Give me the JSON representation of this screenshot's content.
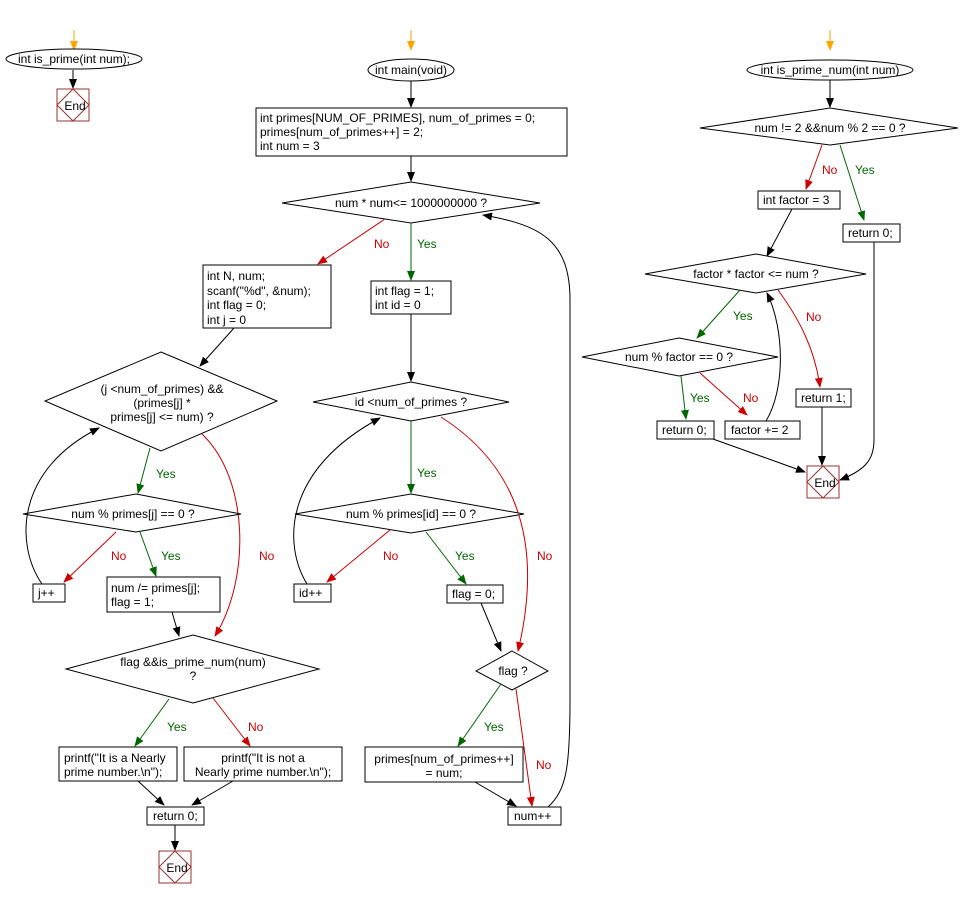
{
  "colors": {
    "start_arrow": "#ffa500",
    "normal": "#000000",
    "yes": "#006600",
    "no": "#cc0000",
    "end_border": "#993333"
  },
  "labels": {
    "yes": "Yes",
    "no": "No",
    "end": "End"
  },
  "is_prime": {
    "start": "int is_prime(int num);",
    "end": "End"
  },
  "main": {
    "start": "int main(void)",
    "init": [
      "int primes[NUM_OF_PRIMES], num_of_primes = 0;",
      "primes[num_of_primes++] = 2;",
      "int num = 3"
    ],
    "cond_outer": "num * num<= 1000000000 ?",
    "read_input": [
      "int N, num;",
      "scanf(\"%d\", &num);",
      "int flag = 0;",
      "int j = 0"
    ],
    "cond_j": [
      "(j <num_of_primes) &&",
      "(primes[j] *",
      "primes[j] <= num) ?"
    ],
    "cond_mod_j": "num % primes[j] == 0 ?",
    "j_inc": "j++",
    "divide": [
      "num /= primes[j];",
      "flag = 1;"
    ],
    "cond_final": [
      "flag &&is_prime_num(num)",
      "?"
    ],
    "print_yes": [
      "printf(\"It is a Nearly",
      "prime number.\\n\");"
    ],
    "print_no": [
      "printf(\"It is not a",
      "Nearly prime number.\\n\");"
    ],
    "return0": "return 0;",
    "end": "End",
    "flag_init": [
      "int flag = 1;",
      "int id = 0"
    ],
    "cond_id": "id <num_of_primes ?",
    "cond_mod_id": "num % primes[id] == 0 ?",
    "id_inc": "id++",
    "flag_zero": "flag = 0;",
    "cond_flag": "flag ?",
    "store_prime": [
      "primes[num_of_primes++]",
      "= num;"
    ],
    "num_inc": "num++"
  },
  "is_prime_num": {
    "start": "int is_prime_num(int num)",
    "cond_even": "num != 2 &&num % 2 == 0 ?",
    "factor_init": "int factor = 3",
    "return0_top": "return 0;",
    "cond_factor": "factor * factor <= num ?",
    "cond_mod_factor": "num % factor == 0 ?",
    "return0": "return 0;",
    "factor_inc": "factor += 2",
    "return1": "return 1;",
    "end": "End"
  }
}
